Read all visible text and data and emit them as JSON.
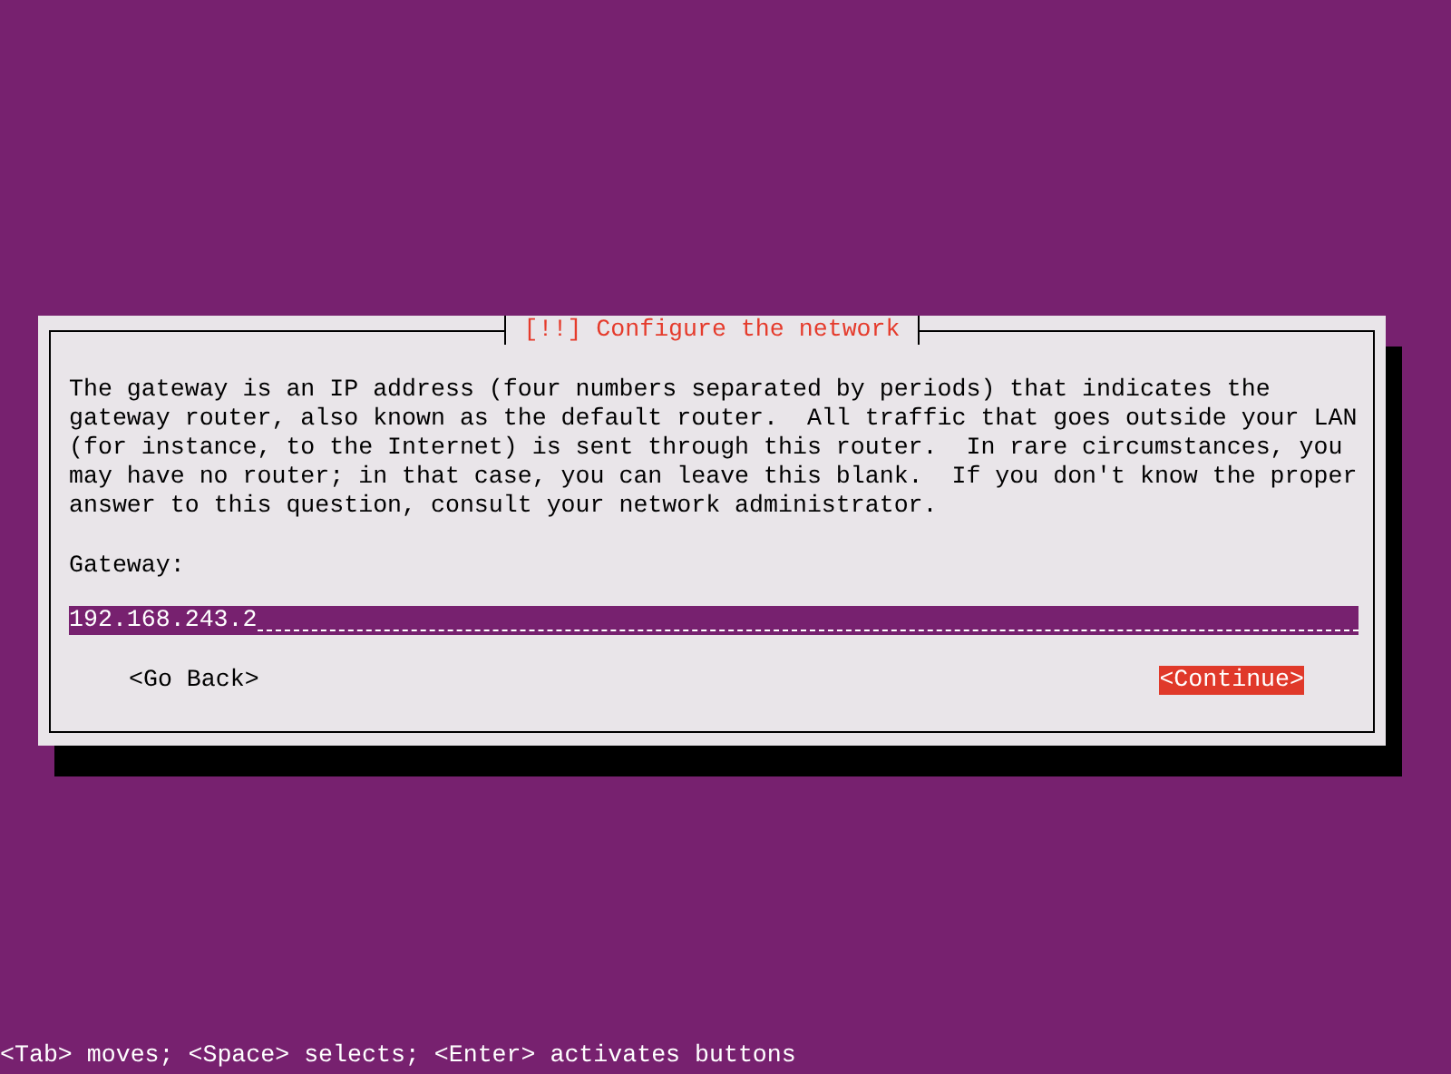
{
  "dialog": {
    "title": "[!!] Configure the network",
    "description": "The gateway is an IP address (four numbers separated by periods) that indicates the\ngateway router, also known as the default router.  All traffic that goes outside your LAN\n(for instance, to the Internet) is sent through this router.  In rare circumstances, you\nmay have no router; in that case, you can leave this blank.  If you don't know the proper\nanswer to this question, consult your network administrator.",
    "field": {
      "label": "Gateway:",
      "value": "192.168.243.2"
    },
    "buttons": [
      {
        "label": "<Go Back>",
        "selected": false
      },
      {
        "label": "<Continue>",
        "selected": true
      }
    ]
  },
  "status_bar": "<Tab> moves; <Space> selects; <Enter> activates buttons"
}
